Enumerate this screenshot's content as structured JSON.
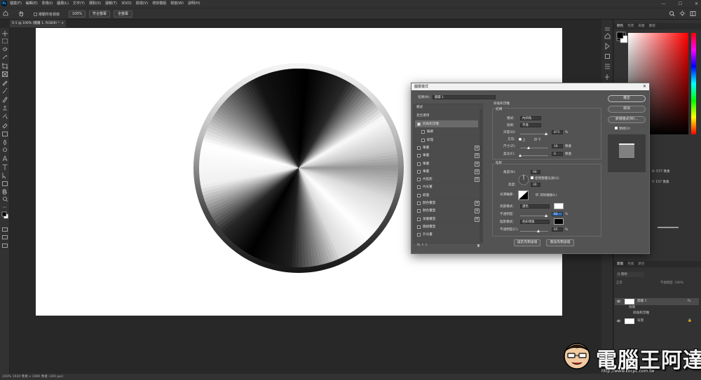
{
  "menubar": {
    "app_icon": "Ps",
    "items": [
      "檔案(F)",
      "編輯(E)",
      "影像(I)",
      "圖層(L)",
      "文字(Y)",
      "選取(S)",
      "濾鏡(T)",
      "3D(D)",
      "檢視(V)",
      "增效模組",
      "視窗(W)",
      "說明(H)"
    ]
  },
  "optionsbar": {
    "scroll_all": "捲動所有視窗",
    "zoom": "100%",
    "fit_screen": "符合螢幕",
    "fill_screen": "全螢幕"
  },
  "document": {
    "tab_title": "0-1 @ 100% (圖層 1, RGB/8) *",
    "status": "100%   1920 像素 x 1080 像素 (300 ppi)"
  },
  "right_panels": {
    "color_tabs": [
      "顏色",
      "色票",
      "漸層",
      "圖樣"
    ],
    "properties_values": {
      "x": "X: 577 像素",
      "y": "Y: 157 像素"
    },
    "layers_tabs": [
      "圖層",
      "色版",
      "路徑"
    ],
    "layers_kind": "Q 種類",
    "layers_blend": "正常",
    "layers_opacity": "不透明度: 100%",
    "layers": [
      {
        "name": "圖層 1",
        "fx": "fx",
        "selected": true
      },
      {
        "name": "效果",
        "sub": true
      },
      {
        "name": "斜角和浮雕",
        "sub": true
      },
      {
        "name": "背景",
        "locked": true
      }
    ]
  },
  "dialog": {
    "title": "圖層樣式",
    "close_label": "✕",
    "name_label": "名稱(N):",
    "name_value": "圖層 1",
    "styles_header": "樣式",
    "blend_options": "混合選項",
    "styles": [
      {
        "label": "斜角和浮雕",
        "checked": true,
        "plus": false
      },
      {
        "label": "輪廓",
        "checked": false,
        "plus": false,
        "indent": true
      },
      {
        "label": "紋理",
        "checked": false,
        "plus": false,
        "indent": true
      },
      {
        "label": "筆畫",
        "checked": false,
        "plus": true
      },
      {
        "label": "筆畫",
        "checked": false,
        "plus": true
      },
      {
        "label": "筆畫",
        "checked": false,
        "plus": true
      },
      {
        "label": "筆畫",
        "checked": false,
        "plus": true
      },
      {
        "label": "內陰影",
        "checked": false,
        "plus": true
      },
      {
        "label": "內光暈",
        "checked": false,
        "plus": false
      },
      {
        "label": "緞面",
        "checked": false,
        "plus": false
      },
      {
        "label": "顏色覆蓋",
        "checked": false,
        "plus": true
      },
      {
        "label": "顏色覆蓋",
        "checked": false,
        "plus": true
      },
      {
        "label": "漸層覆蓋",
        "checked": false,
        "plus": true
      },
      {
        "label": "圖樣覆蓋",
        "checked": false,
        "plus": false
      },
      {
        "label": "外光暈",
        "checked": false,
        "plus": false
      }
    ],
    "bottom_icons": "fx  ⇧  ⇩",
    "section_title": "斜角和浮雕",
    "structure_label": "結構",
    "style_label": "樣式:",
    "style_value": "內斜角",
    "technique_label": "技術:",
    "technique_value": "平滑",
    "depth_label": "深度(D):",
    "depth_value": "875",
    "depth_unit": "%",
    "direction_label": "方向:",
    "dir_up": "上",
    "dir_down": "下",
    "size_label": "尺寸(Z):",
    "size_value": "18",
    "size_unit": "像素",
    "soften_label": "柔化(F):",
    "soften_value": "0",
    "soften_unit": "像素",
    "shading_label": "陰影",
    "angle_label": "角度(N):",
    "angle_value": "90",
    "global_light": "使用整體光源(G)",
    "altitude_label": "高度:",
    "altitude_value": "30",
    "gloss_label": "光澤輪廓:",
    "antialias": "消除鋸齒(L)",
    "highlight_mode_label": "亮部模式:",
    "highlight_mode_value": "濾色",
    "highlight_color": "#ffffff",
    "opacity1_label": "不透明度:",
    "opacity1_value": "92",
    "opacity_unit": "%",
    "shadow_mode_label": "陰影模式:",
    "shadow_mode_value": "色彩增值",
    "shadow_color": "#000000",
    "opacity2_label": "不透明度(C):",
    "opacity2_value": "65",
    "make_default": "設定為預設值",
    "reset_default": "重設為預設值",
    "ok": "確定",
    "cancel": "取消",
    "new_style": "新增樣式(W)...",
    "preview": "預視(V)"
  },
  "watermark": {
    "text": "電腦王阿達",
    "url": "http://www.kocpc.com.tw"
  }
}
